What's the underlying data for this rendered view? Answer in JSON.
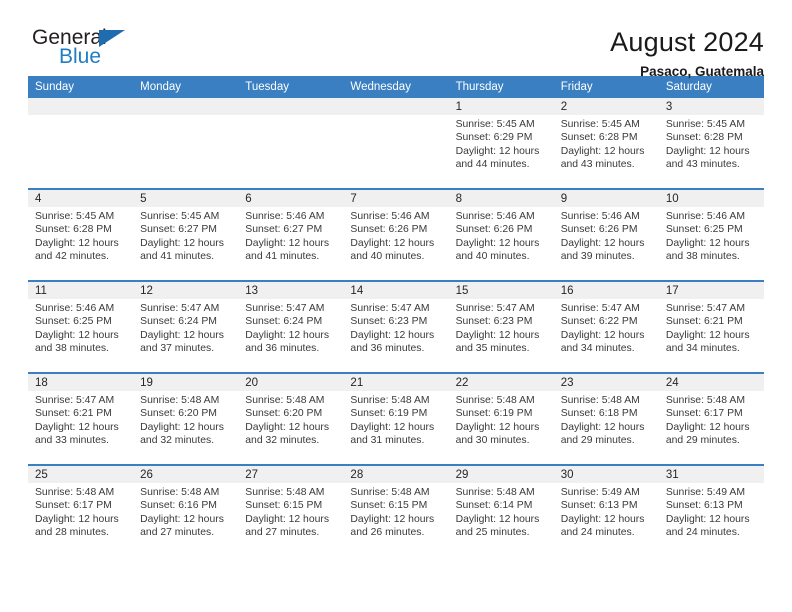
{
  "brand": {
    "name_part1": "General",
    "name_part2": "Blue",
    "flag_icon": "triangle-flag-icon",
    "accent_color": "#1f6cb0"
  },
  "header": {
    "title": "August 2024",
    "location": "Pasaco, Guatemala"
  },
  "calendar": {
    "header_bg": "#3a7fc1",
    "daynum_bg": "#f0f0f0",
    "weekday_headers": [
      "Sunday",
      "Monday",
      "Tuesday",
      "Wednesday",
      "Thursday",
      "Friday",
      "Saturday"
    ],
    "labels": {
      "sunrise": "Sunrise:",
      "sunset": "Sunset:",
      "daylight": "Daylight:"
    },
    "weeks": [
      [
        {
          "day": "",
          "empty": true
        },
        {
          "day": "",
          "empty": true
        },
        {
          "day": "",
          "empty": true
        },
        {
          "day": "",
          "empty": true
        },
        {
          "day": "1",
          "sunrise": "Sunrise: 5:45 AM",
          "sunset": "Sunset: 6:29 PM",
          "daylight_line1": "Daylight: 12 hours",
          "daylight_line2": "and 44 minutes."
        },
        {
          "day": "2",
          "sunrise": "Sunrise: 5:45 AM",
          "sunset": "Sunset: 6:28 PM",
          "daylight_line1": "Daylight: 12 hours",
          "daylight_line2": "and 43 minutes."
        },
        {
          "day": "3",
          "sunrise": "Sunrise: 5:45 AM",
          "sunset": "Sunset: 6:28 PM",
          "daylight_line1": "Daylight: 12 hours",
          "daylight_line2": "and 43 minutes."
        }
      ],
      [
        {
          "day": "4",
          "sunrise": "Sunrise: 5:45 AM",
          "sunset": "Sunset: 6:28 PM",
          "daylight_line1": "Daylight: 12 hours",
          "daylight_line2": "and 42 minutes."
        },
        {
          "day": "5",
          "sunrise": "Sunrise: 5:45 AM",
          "sunset": "Sunset: 6:27 PM",
          "daylight_line1": "Daylight: 12 hours",
          "daylight_line2": "and 41 minutes."
        },
        {
          "day": "6",
          "sunrise": "Sunrise: 5:46 AM",
          "sunset": "Sunset: 6:27 PM",
          "daylight_line1": "Daylight: 12 hours",
          "daylight_line2": "and 41 minutes."
        },
        {
          "day": "7",
          "sunrise": "Sunrise: 5:46 AM",
          "sunset": "Sunset: 6:26 PM",
          "daylight_line1": "Daylight: 12 hours",
          "daylight_line2": "and 40 minutes."
        },
        {
          "day": "8",
          "sunrise": "Sunrise: 5:46 AM",
          "sunset": "Sunset: 6:26 PM",
          "daylight_line1": "Daylight: 12 hours",
          "daylight_line2": "and 40 minutes."
        },
        {
          "day": "9",
          "sunrise": "Sunrise: 5:46 AM",
          "sunset": "Sunset: 6:26 PM",
          "daylight_line1": "Daylight: 12 hours",
          "daylight_line2": "and 39 minutes."
        },
        {
          "day": "10",
          "sunrise": "Sunrise: 5:46 AM",
          "sunset": "Sunset: 6:25 PM",
          "daylight_line1": "Daylight: 12 hours",
          "daylight_line2": "and 38 minutes."
        }
      ],
      [
        {
          "day": "11",
          "sunrise": "Sunrise: 5:46 AM",
          "sunset": "Sunset: 6:25 PM",
          "daylight_line1": "Daylight: 12 hours",
          "daylight_line2": "and 38 minutes."
        },
        {
          "day": "12",
          "sunrise": "Sunrise: 5:47 AM",
          "sunset": "Sunset: 6:24 PM",
          "daylight_line1": "Daylight: 12 hours",
          "daylight_line2": "and 37 minutes."
        },
        {
          "day": "13",
          "sunrise": "Sunrise: 5:47 AM",
          "sunset": "Sunset: 6:24 PM",
          "daylight_line1": "Daylight: 12 hours",
          "daylight_line2": "and 36 minutes."
        },
        {
          "day": "14",
          "sunrise": "Sunrise: 5:47 AM",
          "sunset": "Sunset: 6:23 PM",
          "daylight_line1": "Daylight: 12 hours",
          "daylight_line2": "and 36 minutes."
        },
        {
          "day": "15",
          "sunrise": "Sunrise: 5:47 AM",
          "sunset": "Sunset: 6:23 PM",
          "daylight_line1": "Daylight: 12 hours",
          "daylight_line2": "and 35 minutes."
        },
        {
          "day": "16",
          "sunrise": "Sunrise: 5:47 AM",
          "sunset": "Sunset: 6:22 PM",
          "daylight_line1": "Daylight: 12 hours",
          "daylight_line2": "and 34 minutes."
        },
        {
          "day": "17",
          "sunrise": "Sunrise: 5:47 AM",
          "sunset": "Sunset: 6:21 PM",
          "daylight_line1": "Daylight: 12 hours",
          "daylight_line2": "and 34 minutes."
        }
      ],
      [
        {
          "day": "18",
          "sunrise": "Sunrise: 5:47 AM",
          "sunset": "Sunset: 6:21 PM",
          "daylight_line1": "Daylight: 12 hours",
          "daylight_line2": "and 33 minutes."
        },
        {
          "day": "19",
          "sunrise": "Sunrise: 5:48 AM",
          "sunset": "Sunset: 6:20 PM",
          "daylight_line1": "Daylight: 12 hours",
          "daylight_line2": "and 32 minutes."
        },
        {
          "day": "20",
          "sunrise": "Sunrise: 5:48 AM",
          "sunset": "Sunset: 6:20 PM",
          "daylight_line1": "Daylight: 12 hours",
          "daylight_line2": "and 32 minutes."
        },
        {
          "day": "21",
          "sunrise": "Sunrise: 5:48 AM",
          "sunset": "Sunset: 6:19 PM",
          "daylight_line1": "Daylight: 12 hours",
          "daylight_line2": "and 31 minutes."
        },
        {
          "day": "22",
          "sunrise": "Sunrise: 5:48 AM",
          "sunset": "Sunset: 6:19 PM",
          "daylight_line1": "Daylight: 12 hours",
          "daylight_line2": "and 30 minutes."
        },
        {
          "day": "23",
          "sunrise": "Sunrise: 5:48 AM",
          "sunset": "Sunset: 6:18 PM",
          "daylight_line1": "Daylight: 12 hours",
          "daylight_line2": "and 29 minutes."
        },
        {
          "day": "24",
          "sunrise": "Sunrise: 5:48 AM",
          "sunset": "Sunset: 6:17 PM",
          "daylight_line1": "Daylight: 12 hours",
          "daylight_line2": "and 29 minutes."
        }
      ],
      [
        {
          "day": "25",
          "sunrise": "Sunrise: 5:48 AM",
          "sunset": "Sunset: 6:17 PM",
          "daylight_line1": "Daylight: 12 hours",
          "daylight_line2": "and 28 minutes."
        },
        {
          "day": "26",
          "sunrise": "Sunrise: 5:48 AM",
          "sunset": "Sunset: 6:16 PM",
          "daylight_line1": "Daylight: 12 hours",
          "daylight_line2": "and 27 minutes."
        },
        {
          "day": "27",
          "sunrise": "Sunrise: 5:48 AM",
          "sunset": "Sunset: 6:15 PM",
          "daylight_line1": "Daylight: 12 hours",
          "daylight_line2": "and 27 minutes."
        },
        {
          "day": "28",
          "sunrise": "Sunrise: 5:48 AM",
          "sunset": "Sunset: 6:15 PM",
          "daylight_line1": "Daylight: 12 hours",
          "daylight_line2": "and 26 minutes."
        },
        {
          "day": "29",
          "sunrise": "Sunrise: 5:48 AM",
          "sunset": "Sunset: 6:14 PM",
          "daylight_line1": "Daylight: 12 hours",
          "daylight_line2": "and 25 minutes."
        },
        {
          "day": "30",
          "sunrise": "Sunrise: 5:49 AM",
          "sunset": "Sunset: 6:13 PM",
          "daylight_line1": "Daylight: 12 hours",
          "daylight_line2": "and 24 minutes."
        },
        {
          "day": "31",
          "sunrise": "Sunrise: 5:49 AM",
          "sunset": "Sunset: 6:13 PM",
          "daylight_line1": "Daylight: 12 hours",
          "daylight_line2": "and 24 minutes."
        }
      ]
    ]
  }
}
